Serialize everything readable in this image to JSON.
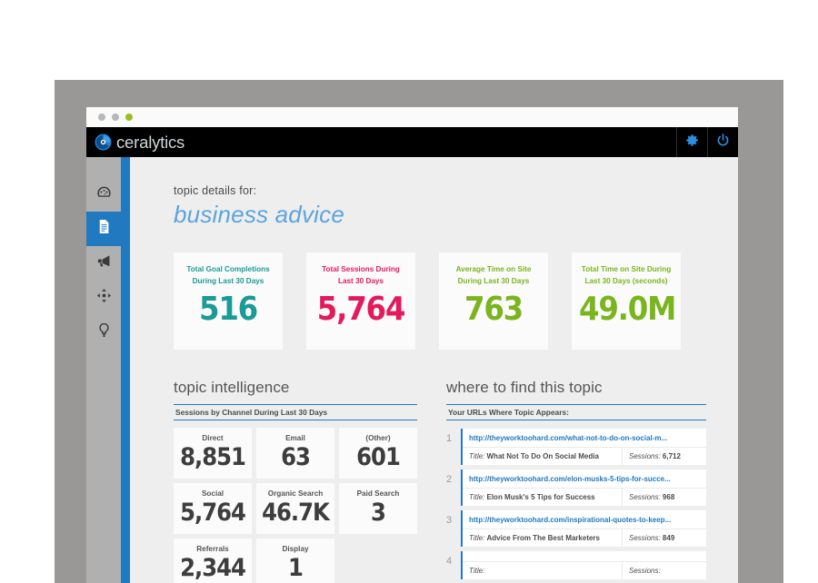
{
  "window": {
    "dots": [
      "gray",
      "gray",
      "green"
    ],
    "logo_text": "ceralytics",
    "header_actions": [
      {
        "name": "settings",
        "icon": "gear-icon"
      },
      {
        "name": "power",
        "icon": "power-icon"
      }
    ]
  },
  "sidebar": {
    "items": [
      {
        "icon": "dashboard-gauge-icon",
        "active": false
      },
      {
        "icon": "document-icon",
        "active": true
      },
      {
        "icon": "megaphone-icon",
        "active": false
      },
      {
        "icon": "move-arrows-icon",
        "active": false
      },
      {
        "icon": "lightbulb-icon",
        "active": false
      }
    ]
  },
  "page": {
    "pretitle": "topic details for:",
    "title": "business advice"
  },
  "stats": [
    {
      "label": "Total Goal Completions During Last 30 Days",
      "value": "516",
      "color": "#1a9b96"
    },
    {
      "label": "Total Sessions During Last 30 Days",
      "value": "5,764",
      "color": "#e31b5d"
    },
    {
      "label": "Average Time on Site During Last 30 Days",
      "value": "763",
      "color": "#7ab51d"
    },
    {
      "label": "Total Time on Site During Last 30 Days (seconds)",
      "value": "49.0M",
      "color": "#7ab51d"
    }
  ],
  "topic_intelligence": {
    "heading": "topic intelligence",
    "subtitle": "Sessions by Channel During Last 30 Days",
    "channels": [
      {
        "label": "Direct",
        "value": "8,851"
      },
      {
        "label": "Email",
        "value": "63"
      },
      {
        "label": "(Other)",
        "value": "601"
      },
      {
        "label": "Social",
        "value": "5,764"
      },
      {
        "label": "Organic Search",
        "value": "46.7K"
      },
      {
        "label": "Paid Search",
        "value": "3"
      },
      {
        "label": "Referrals",
        "value": "2,344"
      },
      {
        "label": "Display",
        "value": "1"
      }
    ]
  },
  "where_to_find": {
    "heading": "where to find this topic",
    "subtitle": "Your URLs Where Topic Appears:",
    "title_label": "Title:",
    "sessions_label": "Sessions:",
    "rows": [
      {
        "num": "1",
        "url": "http://theyworktoohard.com/what-not-to-do-on-social-m...",
        "title": "What Not To Do On Social Media",
        "sessions": "6,712"
      },
      {
        "num": "2",
        "url": "http://theyworktoohard.com/elon-musks-5-tips-for-succe...",
        "title": "Elon Musk's 5 Tips for Success",
        "sessions": "968"
      },
      {
        "num": "3",
        "url": "http://theyworktoohard.com/inspirational-quotes-to-keep...",
        "title": "Advice From The Best Marketers",
        "sessions": "849"
      },
      {
        "num": "4",
        "url": "",
        "title": "",
        "sessions": ""
      }
    ]
  },
  "colors": {
    "accent_blue": "#2179bf",
    "title_blue": "#5ba4dd",
    "teal": "#1a9b96",
    "pink": "#e31b5d",
    "green": "#7ab51d",
    "frame_gray": "#9a9897",
    "sidebar_gray": "#b0b0b0"
  }
}
